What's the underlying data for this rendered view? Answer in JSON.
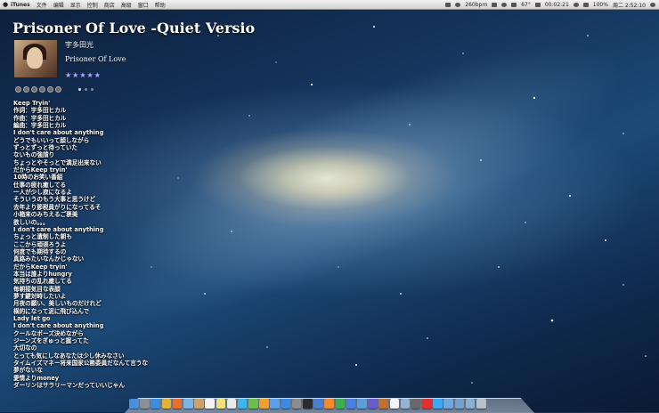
{
  "menubar": {
    "app_name": "iTunes",
    "items": [
      "文件",
      "编辑",
      "显示",
      "控制",
      "商店",
      "高级",
      "窗口",
      "帮助"
    ],
    "status_bpm": "260bpm",
    "status_time_small": "00:02:21",
    "status_temp": "67°",
    "battery": "100%",
    "clock": "周二 2:52:10"
  },
  "track": {
    "title": "Prisoner Of Love -Quiet Versio",
    "artist": "宇多田光",
    "album": "Prisoner Of Love",
    "rating": "★★★★★"
  },
  "lyrics": [
    "Keep Tryin'",
    "作詞：宇多田ヒカル",
    "作曲：宇多田ヒカル",
    "編曲：宇多田ヒカル",
    "I don't care about anything",
    "どうでもいいって顔しながら",
    "ずっとずっと待っていた",
    "ないもの強請り",
    "ちょっとやそっとで満足出来ない",
    "だからKeep tryin'",
    "10時のお笑い番組",
    "仕事の疲れ癒してる",
    "一人が少し寂になるよ",
    "そういうのもう大事と思うけど",
    "去年より節税員がりになってるそ",
    "小箱来のみちえるご褒美",
    "欲しいの。。。",
    "I don't care about anything",
    "ちょっと遺制した朝も",
    "ここから頑張ろうよ",
    "何度でも期待するの",
    "真路みたいなんかじゃない",
    "だからKeep tryin'",
    "本当は誰よりhungry",
    "気持ちの乱れ癒してる",
    "毎朝接気目な表顔",
    "夢す鍵対峙したいよ",
    "月夜の願い、美しいものだけれど",
    "横的になって泥に飛び込んで",
    "Lady let go",
    "I don't care about anything",
    "クールなポーズ決めながら",
    "ジーンズをぎゅっと握ってた",
    "大切なの",
    "とっても気にしなあなたは少し休みなさい",
    "タイムイズマネー将来国家公務委員だなんて言うな",
    "夢がないな",
    "愛情よりmoney",
    "ダーリンはサラリーマンだっていいじゃん"
  ],
  "dock_apps": [
    "finder-icon",
    "launchpad-icon",
    "safari-icon",
    "chrome-icon",
    "firefox-icon",
    "mail-icon",
    "contacts-icon",
    "calendar-icon",
    "notes-icon",
    "reminders-icon",
    "messages-icon",
    "facetime-icon",
    "photos-icon",
    "itunes-icon",
    "app-store-icon",
    "preferences-icon",
    "terminal-icon",
    "xcode-icon",
    "pages-icon",
    "numbers-icon",
    "keynote-icon",
    "iphoto-icon",
    "imovie-icon",
    "garageband-icon",
    "textedit-icon",
    "preview-icon",
    "activity-icon",
    "qq-icon",
    "twitter-icon",
    "downloads-icon",
    "applications-icon",
    "documents-icon",
    "trash-icon"
  ],
  "dock_colors": [
    "#4a90d9",
    "#8a8f96",
    "#3c8de0",
    "#e0b23a",
    "#e8702a",
    "#7fb2e5",
    "#c9a36b",
    "#f3f3f3",
    "#f2e27a",
    "#e9e9e9",
    "#3fb4e8",
    "#6cc04a",
    "#f0a030",
    "#5aa0e8",
    "#3a8ae0",
    "#8c8c8c",
    "#2b2b2b",
    "#4a7fd0",
    "#f08a2a",
    "#3cb050",
    "#4a80e0",
    "#5c9fd8",
    "#6a5acd",
    "#c07030",
    "#f5f5f5",
    "#9ab0d0",
    "#6a6a6a",
    "#e03030",
    "#40a8f0",
    "#6fa8dc",
    "#7aa0c8",
    "#8ab0d0",
    "#b8c0c8"
  ]
}
